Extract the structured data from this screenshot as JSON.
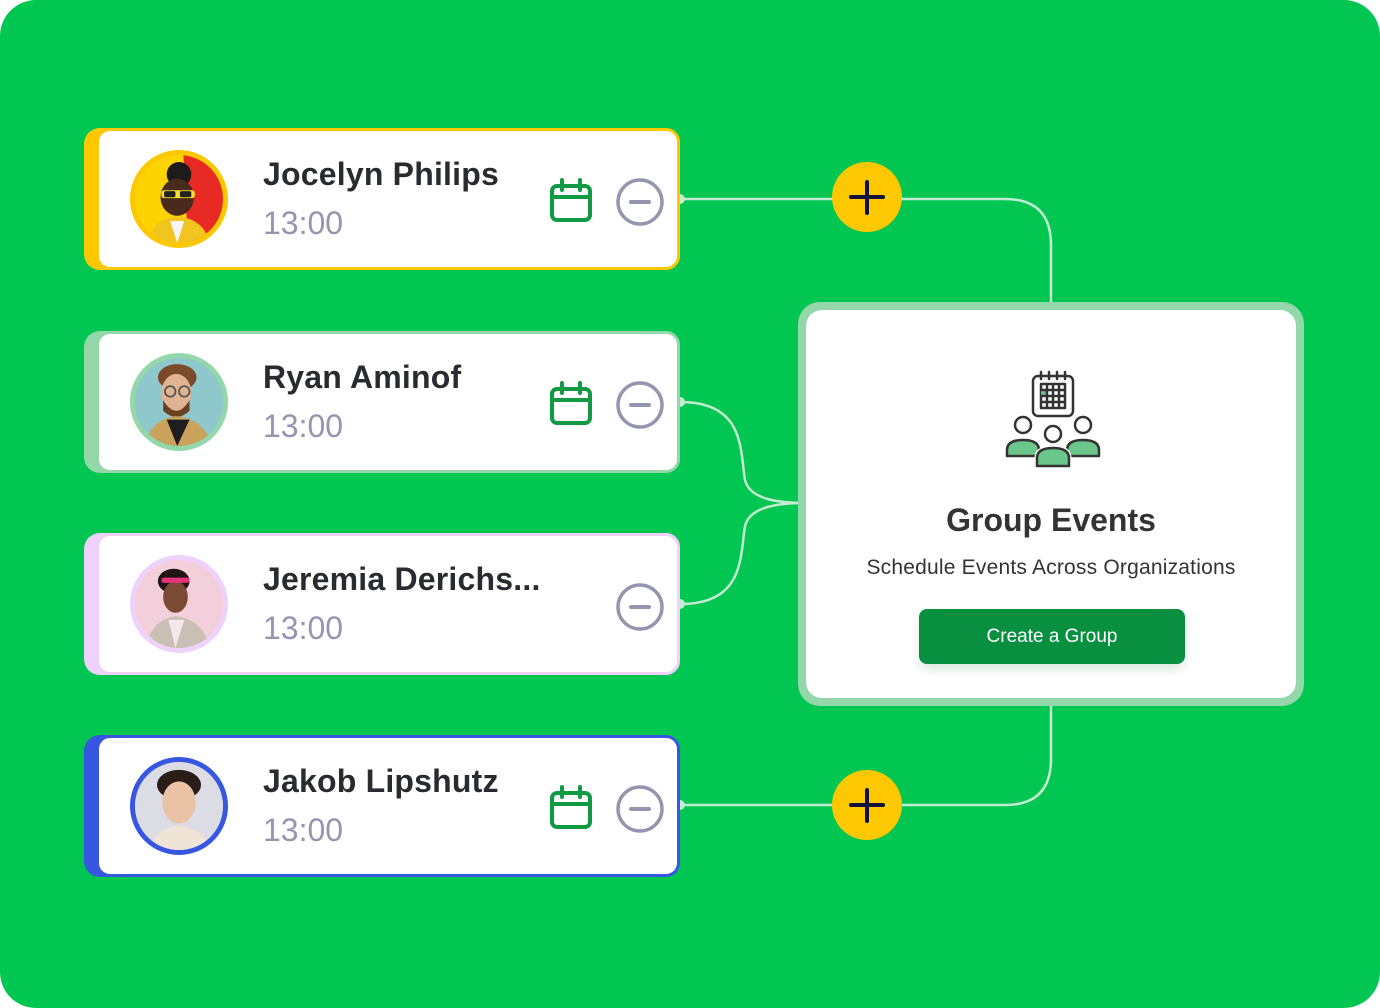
{
  "people": [
    {
      "name": "Jocelyn Philips",
      "time": "13:00",
      "accent": "#fec800",
      "has_calendar": true
    },
    {
      "name": "Ryan Aminof",
      "time": "13:00",
      "accent": "#93d7aa",
      "has_calendar": true
    },
    {
      "name": "Jeremia Derichs...",
      "time": "13:00",
      "accent": "#eed2fb",
      "has_calendar": false
    },
    {
      "name": "Jakob Lipshutz",
      "time": "13:00",
      "accent": "#3757e1",
      "has_calendar": true
    }
  ],
  "group_card": {
    "title": "Group Events",
    "subtitle": "Schedule Events Across Organizations",
    "button_label": "Create a Group"
  },
  "icons": {
    "calendar": "calendar-icon",
    "remove": "minus-circle-icon",
    "add": "plus-icon",
    "group": "group-calendar-icon"
  },
  "colors": {
    "background": "#02c652",
    "button": "#088f3f",
    "plus": "#fec800",
    "calendar": "#119a44",
    "remove": "#9496b0"
  }
}
